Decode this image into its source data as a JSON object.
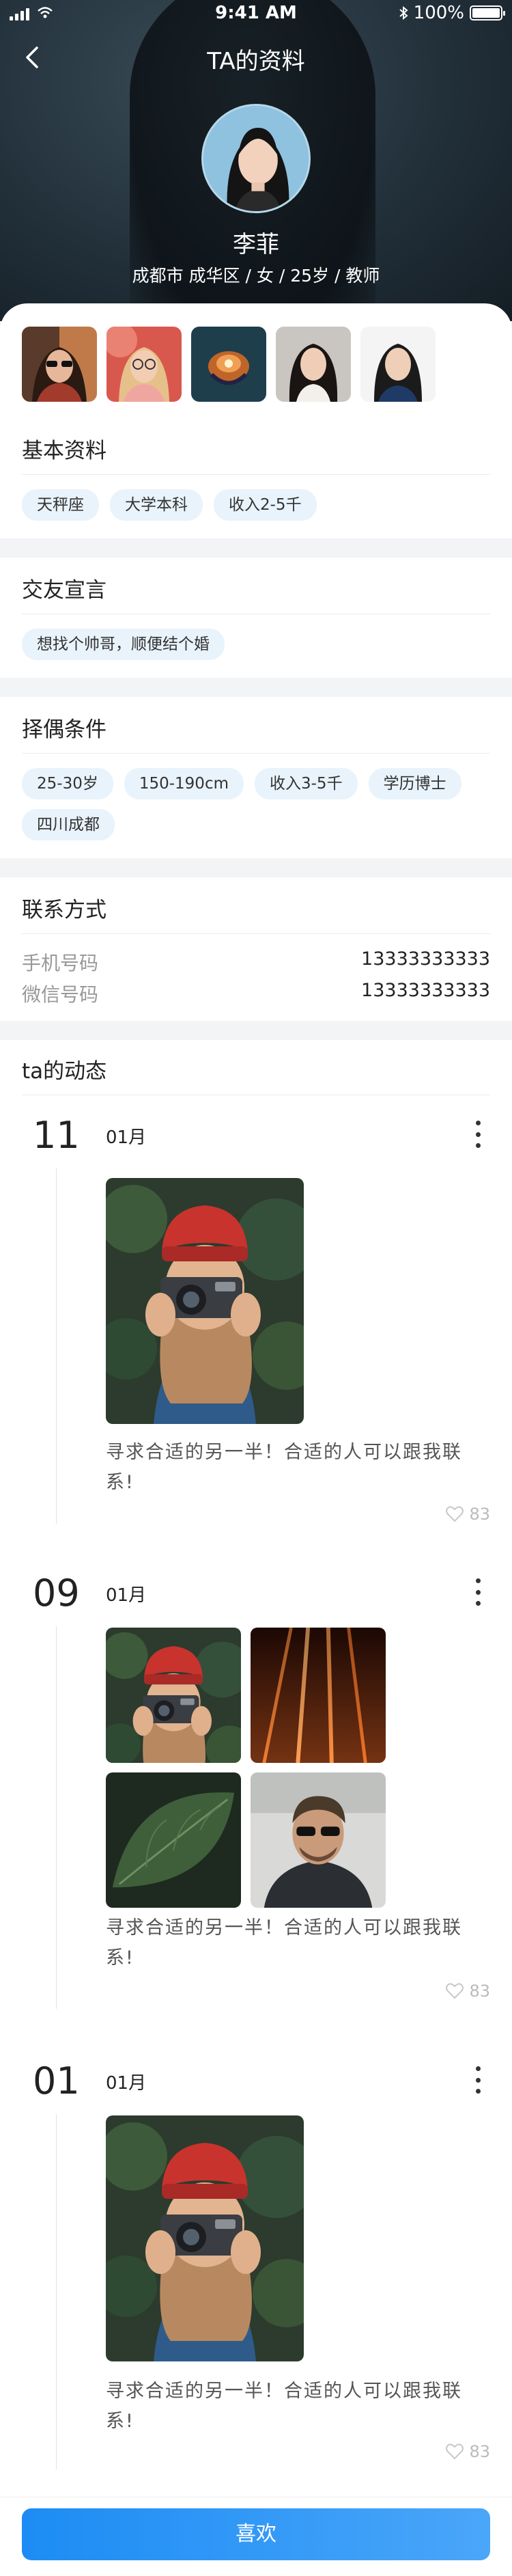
{
  "status_bar": {
    "time": "9:41 AM",
    "battery": "100%"
  },
  "nav": {
    "title": "TA的资料"
  },
  "profile": {
    "name": "李菲",
    "meta": "成都市 成华区 / 女 / 25岁 / 教师"
  },
  "gallery_count": 5,
  "basic": {
    "title": "基本资料",
    "tags": [
      "天秤座",
      "大学本科",
      "收入2-5千"
    ]
  },
  "declaration": {
    "title": "交友宣言",
    "tags": [
      "想找个帅哥，顺便结个婚"
    ]
  },
  "criteria": {
    "title": "择偶条件",
    "tags": [
      "25-30岁",
      "150-190cm",
      "收入3-5千",
      "学历博士",
      "四川成都"
    ]
  },
  "contact": {
    "title": "联系方式",
    "phone_label": "手机号码",
    "phone_value": "13333333333",
    "wechat_label": "微信号码",
    "wechat_value": "13333333333"
  },
  "feed": {
    "title": "ta的动态",
    "posts": [
      {
        "day": "11",
        "month": "01月",
        "text": "寻求合适的另一半！合适的人可以跟我联系!",
        "likes": "83"
      },
      {
        "day": "09",
        "month": "01月",
        "text": "寻求合适的另一半！合适的人可以跟我联系!",
        "likes": "83"
      },
      {
        "day": "01",
        "month": "01月",
        "text": "寻求合适的另一半！合适的人可以跟我联系!",
        "likes": "83"
      }
    ]
  },
  "action": {
    "like_label": "喜欢"
  }
}
